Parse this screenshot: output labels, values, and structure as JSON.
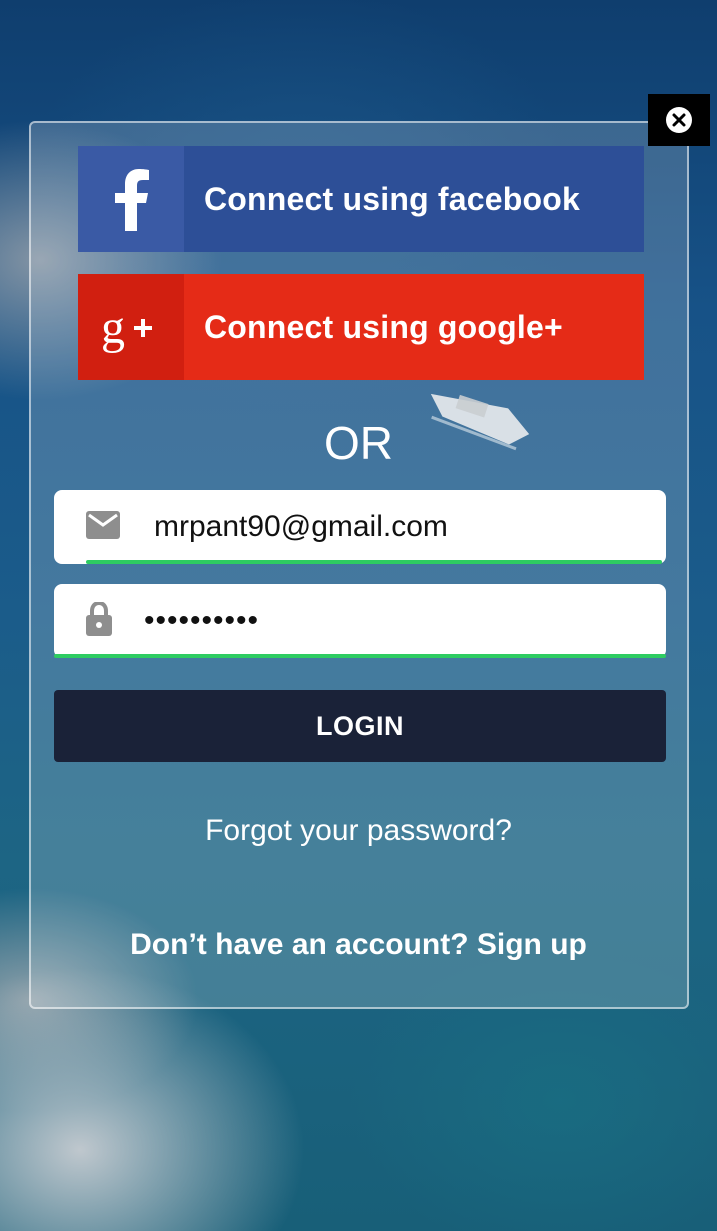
{
  "social": {
    "facebook_label": "Connect using facebook",
    "google_label": "Connect using google+",
    "facebook_color": "#2d4f97",
    "google_color": "#e52b17"
  },
  "divider": {
    "or_text": "OR"
  },
  "form": {
    "email_value": "mrpant90@gmail.com",
    "password_value": "••••••••••",
    "login_label": "LOGIN",
    "underline_color": "#2ecc62",
    "login_color": "#1a2238"
  },
  "links": {
    "forgot_password": "Forgot your password?",
    "no_account_text": "Don’t have an account?",
    "sign_up": "Sign up"
  },
  "icons": {
    "close": "close-icon",
    "facebook": "facebook-icon",
    "google": "google-plus-icon",
    "email": "email-icon",
    "lock": "lock-icon"
  }
}
